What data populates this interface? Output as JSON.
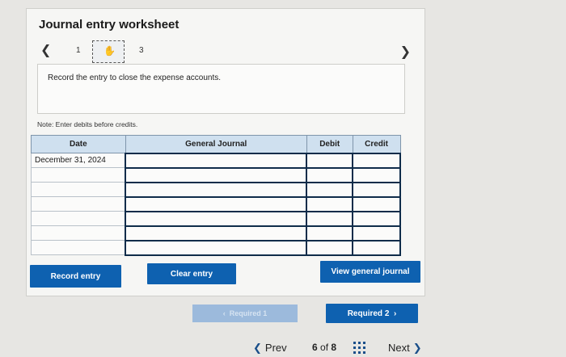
{
  "worksheet": {
    "title": "Journal entry worksheet",
    "steps": [
      "1",
      "",
      "3"
    ],
    "prompt": "Record the entry to close the expense accounts.",
    "note": "Note: Enter debits before credits."
  },
  "table": {
    "headers": {
      "date": "Date",
      "journal": "General Journal",
      "debit": "Debit",
      "credit": "Credit"
    },
    "rows": [
      {
        "date": "December 31, 2024",
        "account": "",
        "debit": "",
        "credit": ""
      },
      {
        "date": "",
        "account": "",
        "debit": "",
        "credit": ""
      },
      {
        "date": "",
        "account": "",
        "debit": "",
        "credit": ""
      },
      {
        "date": "",
        "account": "",
        "debit": "",
        "credit": ""
      },
      {
        "date": "",
        "account": "",
        "debit": "",
        "credit": ""
      },
      {
        "date": "",
        "account": "",
        "debit": "",
        "credit": ""
      },
      {
        "date": "",
        "account": "",
        "debit": "",
        "credit": ""
      }
    ]
  },
  "buttons": {
    "record": "Record entry",
    "clear": "Clear entry",
    "view": "View general journal",
    "required1": "Required 1",
    "required2": "Required 2"
  },
  "nav": {
    "prev": "Prev",
    "current": "6",
    "of_label": "of",
    "total": "8",
    "next": "Next"
  },
  "colors": {
    "accent": "#0e61b0",
    "header_bg": "#cfe0ef",
    "disabled": "#9cbadc"
  },
  "icons": {
    "step2": "hand-pointer-icon",
    "grid": "grid-icon"
  }
}
